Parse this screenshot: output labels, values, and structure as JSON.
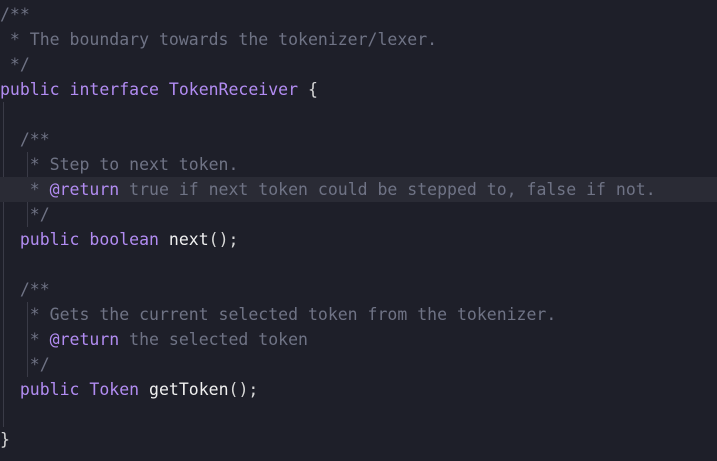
{
  "editor": {
    "lines": [
      [
        {
          "t": "/**",
          "c": "comment"
        }
      ],
      [
        {
          "t": " * The boundary towards the tokenizer/lexer.",
          "c": "comment"
        }
      ],
      [
        {
          "t": " */",
          "c": "comment"
        }
      ],
      [
        {
          "t": "public",
          "c": "kw"
        },
        {
          "t": " ",
          "c": "ident"
        },
        {
          "t": "interface",
          "c": "kw"
        },
        {
          "t": " ",
          "c": "ident"
        },
        {
          "t": "TokenReceiver",
          "c": "type"
        },
        {
          "t": " {",
          "c": "punct"
        }
      ],
      [],
      [
        {
          "t": "  /**",
          "c": "comment"
        }
      ],
      [
        {
          "t": "   * Step to next token.",
          "c": "comment"
        }
      ],
      [
        {
          "t": "   * ",
          "c": "comment"
        },
        {
          "t": "@return",
          "c": "tag"
        },
        {
          "t": " true if next token could be stepped to, false if not.",
          "c": "comment"
        }
      ],
      [
        {
          "t": "   */",
          "c": "comment"
        }
      ],
      [
        {
          "t": "  ",
          "c": "ident"
        },
        {
          "t": "public",
          "c": "kw"
        },
        {
          "t": " ",
          "c": "ident"
        },
        {
          "t": "boolean",
          "c": "kw"
        },
        {
          "t": " ",
          "c": "ident"
        },
        {
          "t": "next",
          "c": "ident"
        },
        {
          "t": "();",
          "c": "punct"
        }
      ],
      [],
      [
        {
          "t": "  /**",
          "c": "comment"
        }
      ],
      [
        {
          "t": "   * Gets the current selected token from the tokenizer.",
          "c": "comment"
        }
      ],
      [
        {
          "t": "   * ",
          "c": "comment"
        },
        {
          "t": "@return",
          "c": "tag"
        },
        {
          "t": " the selected token",
          "c": "comment"
        }
      ],
      [
        {
          "t": "   */",
          "c": "comment"
        }
      ],
      [
        {
          "t": "  ",
          "c": "ident"
        },
        {
          "t": "public",
          "c": "kw"
        },
        {
          "t": " ",
          "c": "ident"
        },
        {
          "t": "Token",
          "c": "type"
        },
        {
          "t": " ",
          "c": "ident"
        },
        {
          "t": "getToken",
          "c": "ident"
        },
        {
          "t": "();",
          "c": "punct"
        }
      ],
      [],
      [
        {
          "t": "}",
          "c": "punct"
        }
      ]
    ],
    "highlighted_line": 7
  }
}
